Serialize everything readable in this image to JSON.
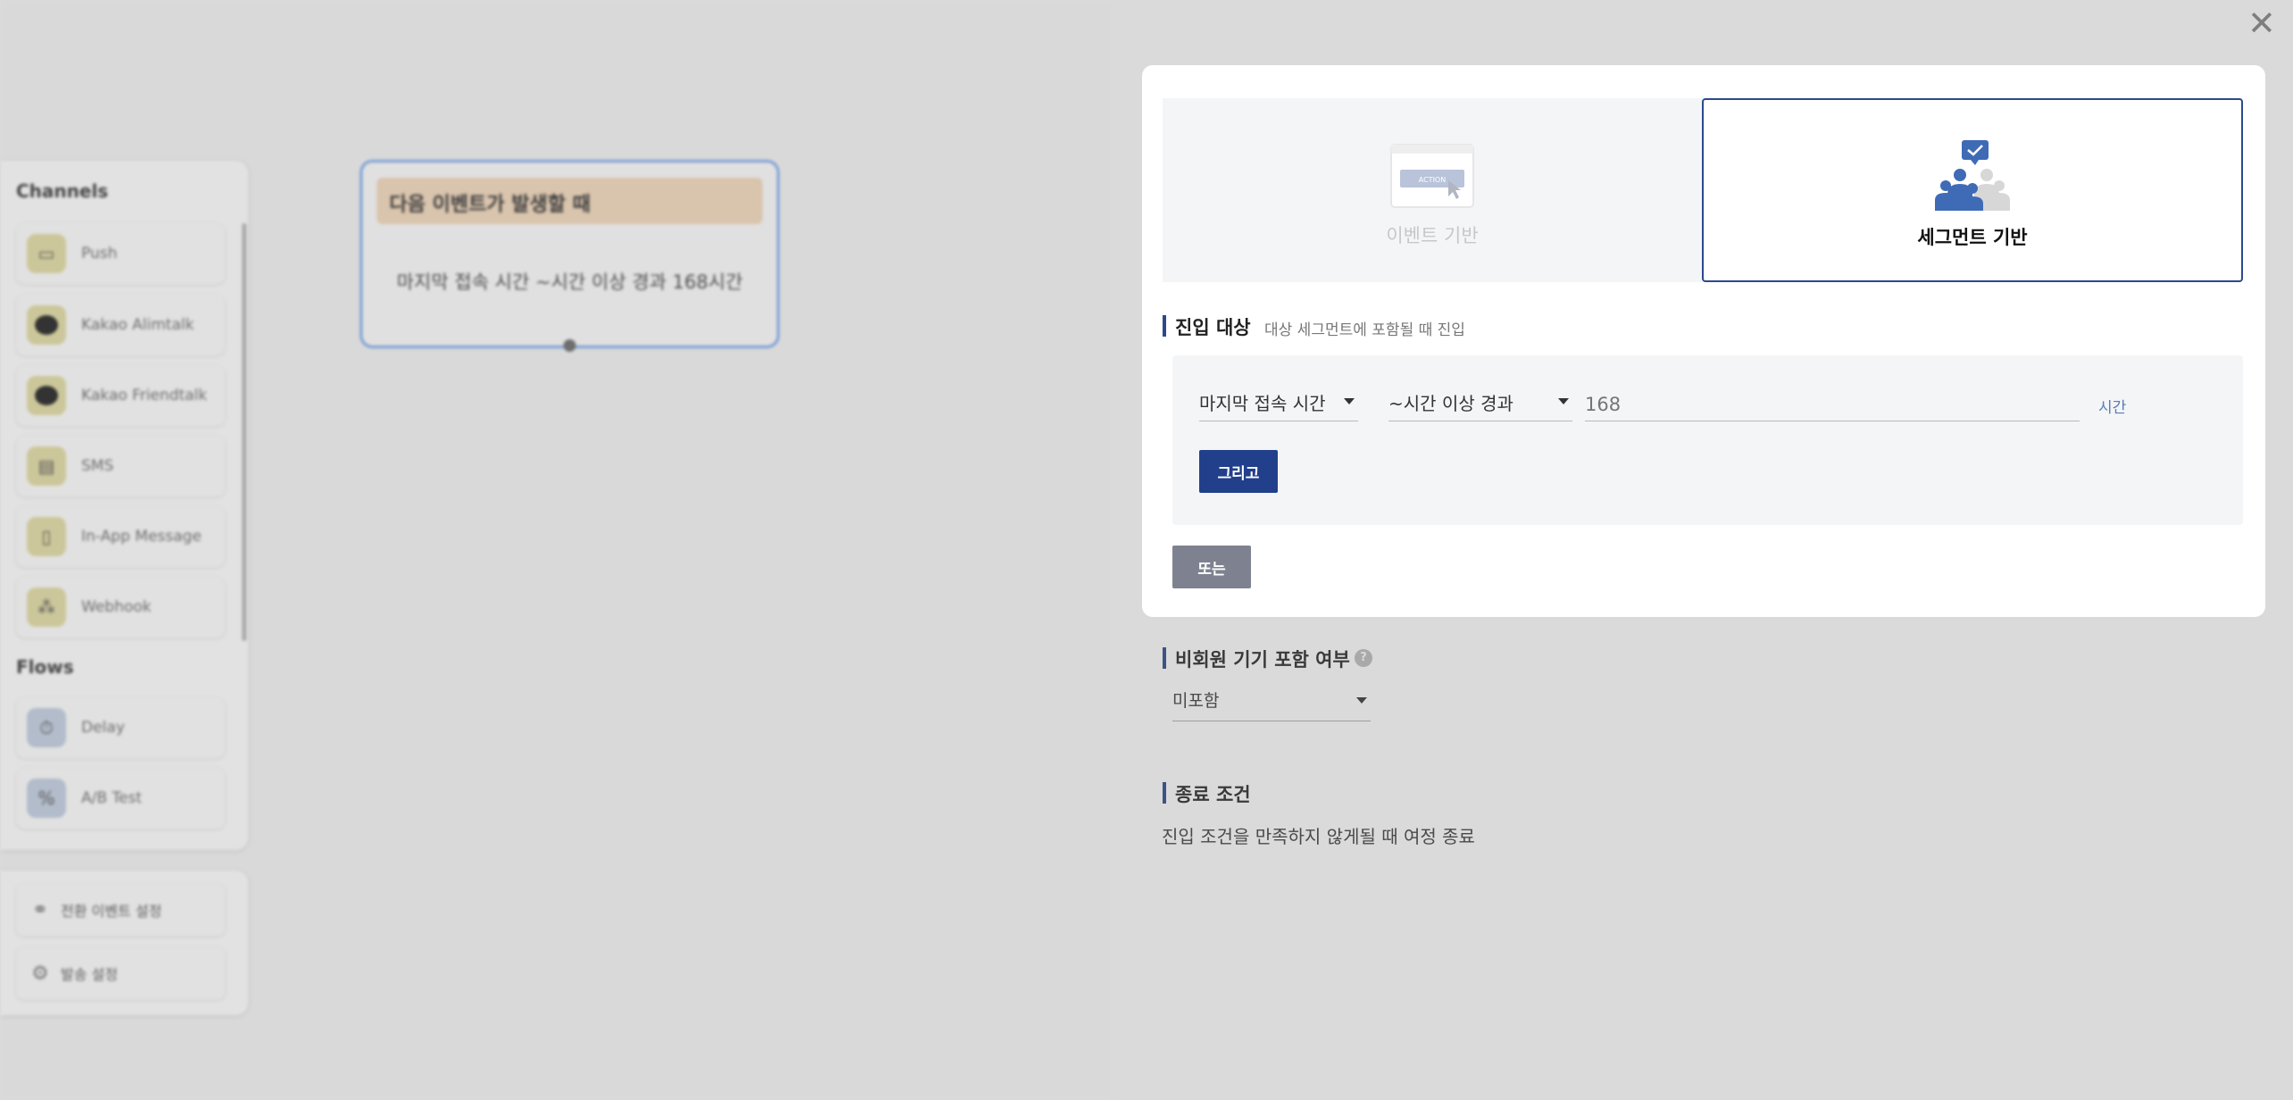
{
  "palette": {
    "channels_title": "Channels",
    "channels": [
      {
        "label": "Push",
        "icon": "push-icon"
      },
      {
        "label": "Kakao Alimtalk",
        "icon": "kakao-icon"
      },
      {
        "label": "Kakao Friendtalk",
        "icon": "kakao-icon"
      },
      {
        "label": "SMS",
        "icon": "sms-icon"
      },
      {
        "label": "In-App Message",
        "icon": "in-app-message-icon"
      },
      {
        "label": "Webhook",
        "icon": "webhook-icon"
      }
    ],
    "flows_title": "Flows",
    "flows": [
      {
        "label": "Delay",
        "icon": "timer-icon"
      },
      {
        "label": "A/B Test",
        "icon": "percent-icon"
      }
    ]
  },
  "utility": {
    "conversion_label": "전환 이벤트 설정",
    "send_settings_label": "발송 설정"
  },
  "trigger_node": {
    "header": "다음 이벤트가 발생할 때",
    "condition": "마지막 접속 시간 ~시간 이상 경과 168시간"
  },
  "panel": {
    "trigger_types": {
      "event_label": "이벤트 기반",
      "event_graphic_text": "ACTION",
      "segment_label": "세그먼트 기반",
      "selected": "segment"
    },
    "entry": {
      "title": "진입 대상",
      "subtitle": "대상 세그먼트에 포함될 때 진입",
      "attribute": "마지막 접속 시간",
      "operator": "~시간 이상 경과",
      "value_placeholder": "168",
      "unit": "시간",
      "and_button": "그리고",
      "or_button": "또는"
    },
    "non_member": {
      "title": "비회원 기기 포함 여부",
      "help": "?",
      "value": "미포함"
    },
    "end_condition": {
      "title": "종료 조건",
      "text": "진입 조건을 만족하지 않게될 때 여정 종료"
    }
  },
  "colors": {
    "accent": "#213f8b",
    "selected_border": "#2b4a8c",
    "node_border": "#7a9ed6",
    "node_header": "#d9c4ad",
    "link_text": "#5b7bb8"
  }
}
